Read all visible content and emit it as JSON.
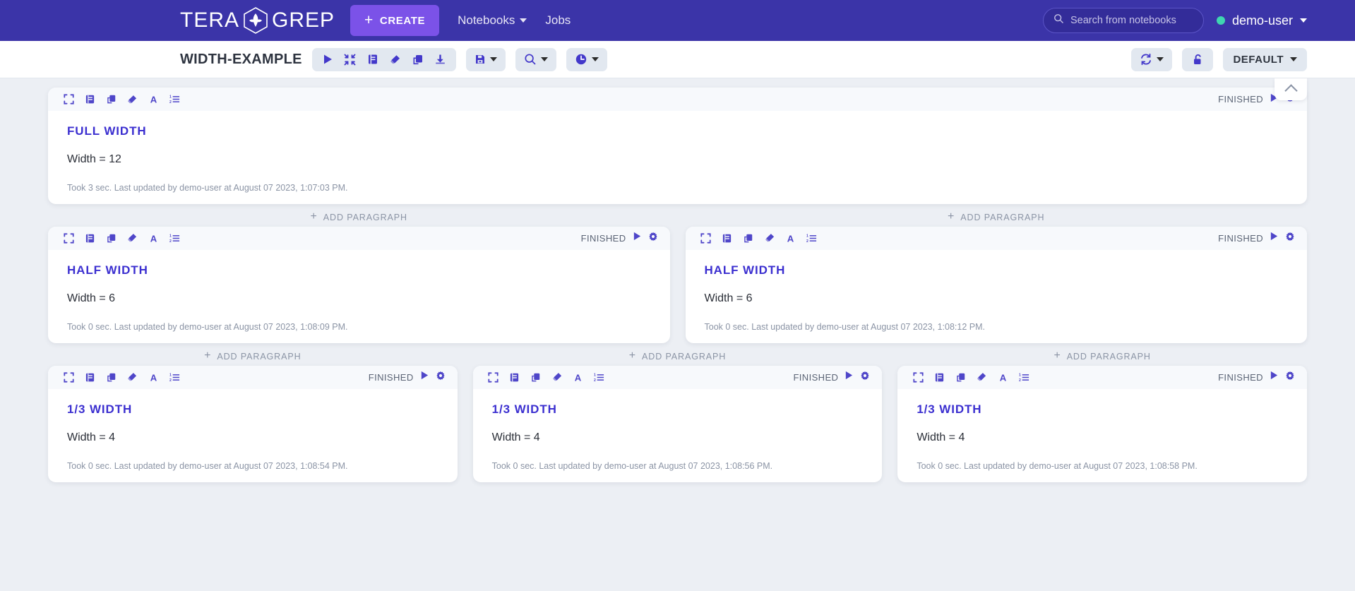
{
  "nav": {
    "brand": "TERA GREP",
    "brand_left": "TERA",
    "brand_right": "GREP",
    "brand_icon": "leaf-hexagon-logo",
    "create_label": "CREATE",
    "notebooks_label": "Notebooks",
    "jobs_label": "Jobs",
    "search_placeholder": "Search from notebooks",
    "user": "demo-user",
    "status_color": "#3fd6b0",
    "bg_color": "#3b34a8",
    "create_color": "#7b52e8"
  },
  "toolbar": {
    "notebook_title": "WIDTH-EXAMPLE",
    "group1": [
      {
        "name": "run-all-paragraphs",
        "icon": "play-icon"
      },
      {
        "name": "collapse-all",
        "icon": "compress-icon"
      },
      {
        "name": "show-hide-code",
        "icon": "book-icon"
      },
      {
        "name": "clear-output",
        "icon": "eraser-icon"
      },
      {
        "name": "clone-notebook",
        "icon": "copy-icon"
      },
      {
        "name": "export-notebook",
        "icon": "download-icon"
      }
    ],
    "group2": [
      {
        "name": "version-control",
        "icon": "save-icon",
        "has_caret": true
      }
    ],
    "group3": [
      {
        "name": "search-code",
        "icon": "search-icon",
        "has_caret": true
      }
    ],
    "group4": [
      {
        "name": "scheduler",
        "icon": "clock-icon",
        "has_caret": true
      }
    ],
    "right_refresh": {
      "name": "refresh-interpreter",
      "icon": "refresh-icon",
      "has_caret": true
    },
    "right_lock": {
      "name": "permissions",
      "icon": "unlock-icon"
    },
    "interpreter_label": "DEFAULT",
    "accent": "#4338ca"
  },
  "content": {
    "collapse_icon": "chevron-up-icon",
    "add_paragraph_label": "ADD PARAGRAPH",
    "status_label": "FINISHED",
    "para_icons": [
      {
        "name": "expand-paragraph",
        "icon": "expand-icon"
      },
      {
        "name": "toggle-editor",
        "icon": "book-icon"
      },
      {
        "name": "clone-paragraph",
        "icon": "copy-icon"
      },
      {
        "name": "clear-paragraph-output",
        "icon": "eraser-icon"
      },
      {
        "name": "toggle-title",
        "icon": "font-a-icon"
      },
      {
        "name": "toggle-line-numbers",
        "icon": "ordered-list-icon"
      }
    ],
    "paragraphs": {
      "full": {
        "title": "FULL WIDTH",
        "text": "Width = 12",
        "footer": "Took 3 sec. Last updated by demo-user at August 07 2023, 1:07:03 PM."
      },
      "half_left": {
        "title": "HALF WIDTH",
        "text": "Width = 6",
        "footer": "Took 0 sec. Last updated by demo-user at August 07 2023, 1:08:09 PM."
      },
      "half_right": {
        "title": "HALF WIDTH",
        "text": "Width = 6",
        "footer": "Took 0 sec. Last updated by demo-user at August 07 2023, 1:08:12 PM."
      },
      "third_one": {
        "title": "1/3 WIDTH",
        "text": "Width = 4",
        "footer": "Took 0 sec. Last updated by demo-user at August 07 2023, 1:08:54 PM."
      },
      "third_two": {
        "title": "1/3 WIDTH",
        "text": "Width = 4",
        "footer": "Took 0 sec. Last updated by demo-user at August 07 2023, 1:08:56 PM."
      },
      "third_three": {
        "title": "1/3 WIDTH",
        "text": "Width = 4",
        "footer": "Took 0 sec. Last updated by demo-user at August 07 2023, 1:08:58 PM."
      }
    }
  }
}
